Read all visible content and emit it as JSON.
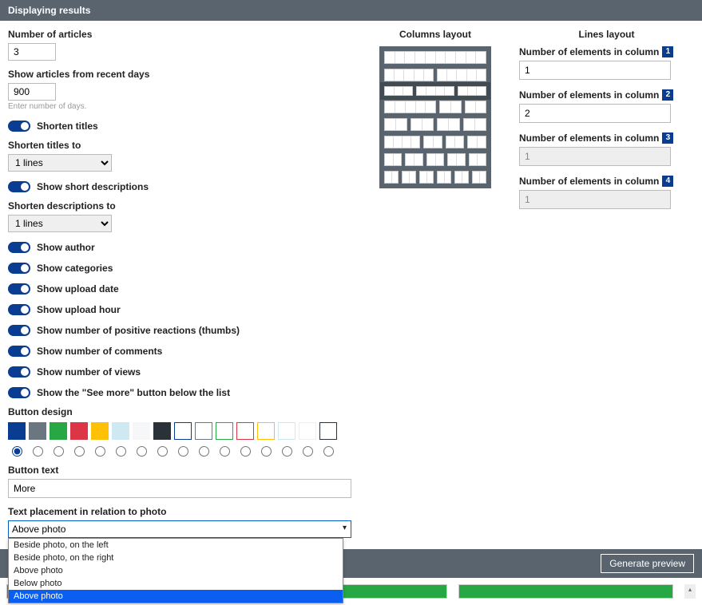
{
  "header": {
    "title": "Displaying results"
  },
  "left": {
    "num_articles_label": "Number of articles",
    "num_articles_value": "3",
    "recent_days_label": "Show articles from recent days",
    "recent_days_value": "900",
    "recent_days_hint": "Enter number of days.",
    "shorten_titles_label": "Shorten titles",
    "shorten_titles_to_label": "Shorten titles to",
    "shorten_titles_to_value": "1 lines",
    "short_desc_label": "Show short descriptions",
    "shorten_desc_to_label": "Shorten descriptions to",
    "shorten_desc_to_value": "1 lines",
    "toggles": [
      "Show author",
      "Show categories",
      "Show upload date",
      "Show upload hour",
      "Show number of positive reactions (thumbs)",
      "Show number of comments",
      "Show number of views",
      "Show the \"See more\" button below the list"
    ],
    "button_design_label": "Button design",
    "swatches": [
      {
        "bg": "#0a3d91",
        "border": ""
      },
      {
        "bg": "#6b7680",
        "border": ""
      },
      {
        "bg": "#28a745",
        "border": ""
      },
      {
        "bg": "#dc3545",
        "border": ""
      },
      {
        "bg": "#ffc107",
        "border": ""
      },
      {
        "bg": "#cfe9f3",
        "border": ""
      },
      {
        "bg": "#f5f7f9",
        "border": ""
      },
      {
        "bg": "#2b3138",
        "border": ""
      },
      {
        "bg": "#ffffff",
        "border": "#0a3d91"
      },
      {
        "bg": "#ffffff",
        "border": "#6b7680"
      },
      {
        "bg": "#ffffff",
        "border": "#28a745"
      },
      {
        "bg": "#ffffff",
        "border": "#dc3545"
      },
      {
        "bg": "#ffffff",
        "border": "#ffc107"
      },
      {
        "bg": "#ffffff",
        "border": "#cfe9f3"
      },
      {
        "bg": "#ffffff",
        "border": "#f0f0f0"
      },
      {
        "bg": "#ffffff",
        "border": "#2b3138"
      }
    ],
    "button_text_label": "Button text",
    "button_text_value": "More",
    "placement_label": "Text placement in relation to photo",
    "placement_value": "Above photo",
    "placement_options": [
      "Beside photo, on the left",
      "Beside photo, on the right",
      "Above photo",
      "Below photo",
      "Above photo"
    ]
  },
  "mid": {
    "heading": "Columns layout",
    "rows": [
      [
        10
      ],
      [
        5,
        5
      ],
      [
        3,
        4,
        3
      ],
      [
        5,
        2,
        2
      ],
      [
        2,
        2,
        2,
        2
      ],
      [
        4,
        2,
        2,
        2
      ],
      [
        2,
        2,
        2,
        2,
        2
      ],
      [
        2,
        2,
        2,
        2,
        2,
        2
      ]
    ],
    "selected_index": 2
  },
  "right": {
    "heading": "Lines layout",
    "items": [
      {
        "label": "Number of elements in column",
        "num": "1",
        "value": "1",
        "disabled": false
      },
      {
        "label": "Number of elements in column",
        "num": "2",
        "value": "2",
        "disabled": false
      },
      {
        "label": "Number of elements in column",
        "num": "3",
        "value": "1",
        "disabled": true
      },
      {
        "label": "Number of elements in column",
        "num": "4",
        "value": "1",
        "disabled": true
      }
    ]
  },
  "footer": {
    "generate": "Generate preview"
  }
}
